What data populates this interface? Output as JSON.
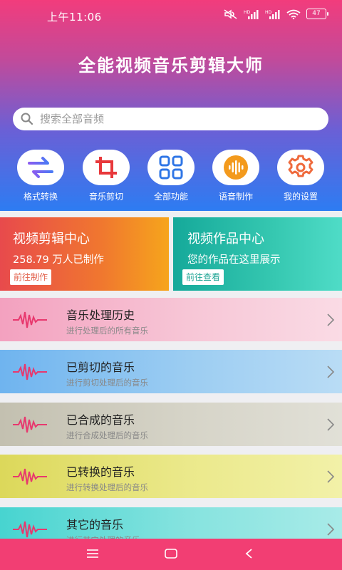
{
  "status_bar": {
    "time": "上午11:06",
    "battery": "47",
    "icons": [
      "mute-icon",
      "signal-hd-icon",
      "signal-hd-icon",
      "wifi-icon",
      "battery-icon"
    ]
  },
  "app_title": "全能视频音乐剪辑大师",
  "search": {
    "placeholder": "搜索全部音频",
    "value": ""
  },
  "quick_actions": [
    {
      "label": "格式转换",
      "icon": "convert-arrows-icon"
    },
    {
      "label": "音乐剪切",
      "icon": "crop-icon"
    },
    {
      "label": "全部功能",
      "icon": "grid-icon"
    },
    {
      "label": "语音制作",
      "icon": "voice-wave-icon"
    },
    {
      "label": "我的设置",
      "icon": "gear-icon"
    }
  ],
  "cards": {
    "left": {
      "title": "视频剪辑中心",
      "subtitle": "258.79 万人已制作",
      "button": "前往制作"
    },
    "right": {
      "title": "视频作品中心",
      "subtitle": "您的作品在这里展示",
      "button": "前往查看"
    }
  },
  "list": [
    {
      "title": "音乐处理历史",
      "subtitle": "进行处理后的所有音乐"
    },
    {
      "title": "已剪切的音乐",
      "subtitle": "进行剪切处理后的音乐"
    },
    {
      "title": "已合成的音乐",
      "subtitle": "进行合成处理后的音乐"
    },
    {
      "title": "已转换的音乐",
      "subtitle": "进行转换处理后的音乐"
    },
    {
      "title": "其它的音乐",
      "subtitle": "进行其它处理的音乐"
    }
  ],
  "colors": {
    "accent": "#f23e73",
    "card_left": "#f0772f",
    "card_right": "#36c8b1",
    "wave": "#e8386e"
  }
}
